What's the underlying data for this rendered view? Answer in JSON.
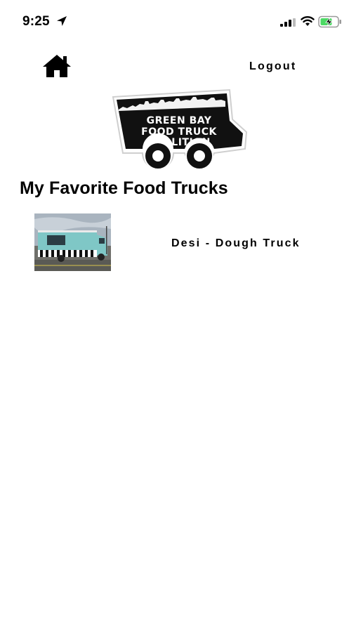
{
  "status_bar": {
    "time": "9:25",
    "icons": [
      "location-arrow-icon",
      "signal-icon",
      "wifi-icon",
      "battery-charging-icon"
    ]
  },
  "header": {
    "home_icon": "home-icon",
    "logout_label": "Logout"
  },
  "logo": {
    "lines": [
      "GREEN BAY",
      "FOOD TRUCK",
      "COALITION"
    ]
  },
  "main": {
    "title": "My Favorite Food Trucks",
    "favorites": [
      {
        "name": "Desi - Dough Truck",
        "image": "desi-dough-truck-photo"
      }
    ]
  },
  "colors": {
    "background": "#ffffff",
    "text": "#000000",
    "battery_green": "#4cd964",
    "truck_teal": "#7fc7c6"
  }
}
